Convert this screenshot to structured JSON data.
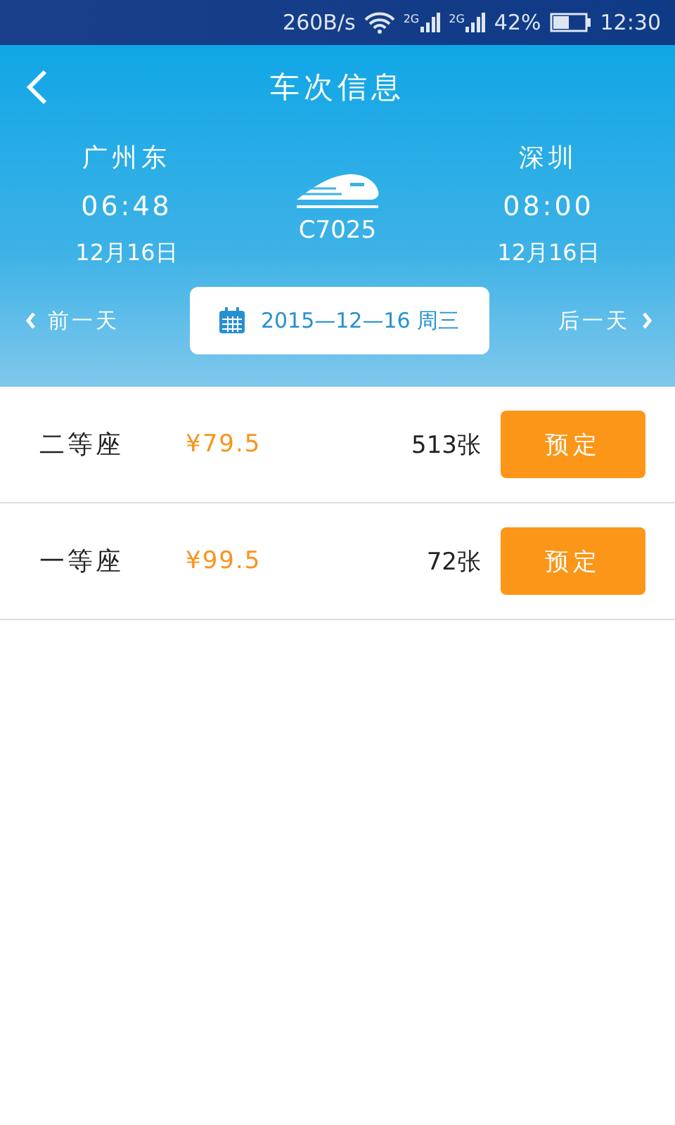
{
  "status_bar": {
    "speed": "260B/s",
    "signals": [
      {
        "network": "2G"
      },
      {
        "network": "2G"
      }
    ],
    "battery": "42%",
    "time": "12:30"
  },
  "header": {
    "title": "车次信息"
  },
  "trip": {
    "departure": {
      "station": "广州东",
      "time": "06:48",
      "date": "12月16日"
    },
    "train": "C7025",
    "arrival": {
      "station": "深圳",
      "time": "08:00",
      "date": "12月16日"
    }
  },
  "date_nav": {
    "previous": "前一天",
    "date": "2015—12—16 周三",
    "next": "后一天"
  },
  "seats": [
    {
      "class": "二等座",
      "price": "¥79.5",
      "count": "513张",
      "action": "预定"
    },
    {
      "class": "一等座",
      "price": "¥99.5",
      "count": "72张",
      "action": "预定"
    }
  ]
}
